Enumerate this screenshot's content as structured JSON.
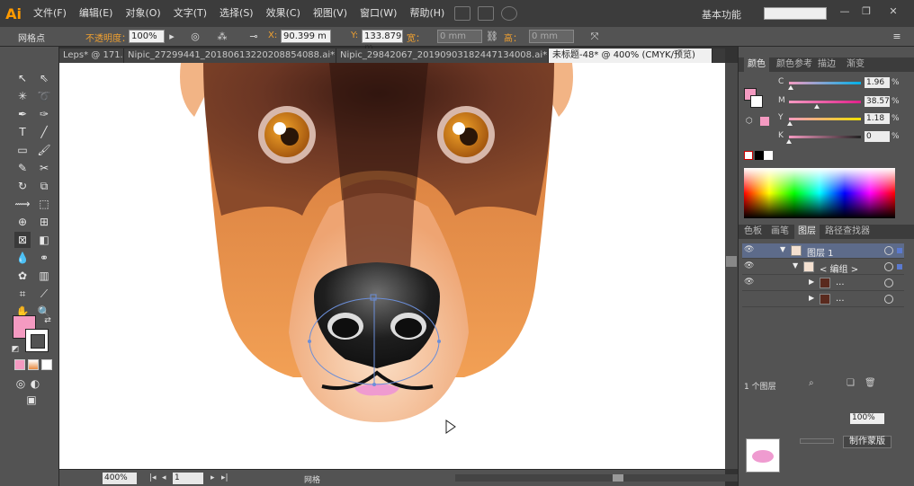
{
  "app": {
    "logo": "Ai",
    "menu": [
      "文件(F)",
      "编辑(E)",
      "对象(O)",
      "文字(T)",
      "选择(S)",
      "效果(C)",
      "视图(V)",
      "窗口(W)",
      "帮助(H)"
    ],
    "workspace": "基本功能"
  },
  "controlbar": {
    "object_type": "网格点",
    "opacity_label": "不透明度：",
    "opacity_value": "100%",
    "x_label": "X:",
    "x_value": "90.399 m",
    "y_label": "Y:",
    "y_value": "133.879 m",
    "width_label": "宽：",
    "width_value": "0 mm",
    "height_label": "高：",
    "height_value": "0 mm"
  },
  "tabs": [
    {
      "label": "Leps* @ 171..."
    },
    {
      "label": "Nipic_27299441_20180613220208854088.ai*"
    },
    {
      "label": "Nipic_29842067_20190903182447134008.ai*"
    },
    {
      "label": "未标题-48* @ 400% (CMYK/预览)",
      "active": true
    }
  ],
  "statusbar": {
    "zoom": "400%",
    "artboard": "1",
    "mode": "网格"
  },
  "color_panel": {
    "tabs": [
      "颜色",
      "颜色参考",
      "描边",
      "渐变"
    ],
    "channels": [
      {
        "label": "C",
        "value": "1.96",
        "fraction": 0.02,
        "color": "#00b0e8"
      },
      {
        "label": "M",
        "value": "38.57",
        "fraction": 0.39,
        "color": "#e0208a"
      },
      {
        "label": "Y",
        "value": "1.18",
        "fraction": 0.01,
        "color": "#f0e000"
      },
      {
        "label": "K",
        "value": "0",
        "fraction": 0.0,
        "color": "#222222"
      }
    ],
    "pct": "%",
    "fill_color": "#f49ac1"
  },
  "layers_panel": {
    "tabs": [
      "色板",
      "画笔",
      "图层",
      "路径查找器"
    ],
    "rows": [
      {
        "name": "图层 1",
        "level": 0
      },
      {
        "name": "< 编组 >",
        "level": 1
      },
      {
        "name": "...",
        "level": 2
      },
      {
        "name": "...",
        "level": 2
      }
    ],
    "footer": "1 个图层"
  },
  "bottom_panel": {
    "value": "100%",
    "button": "制作蒙版"
  },
  "colors": {
    "face_dark": "#5a2a1e",
    "face_orange": "#e8893e",
    "muzzle": "#f6c49c",
    "nose": "#2a2a2a",
    "tongue": "#ef9bd0",
    "eye": "#d98a1c"
  }
}
